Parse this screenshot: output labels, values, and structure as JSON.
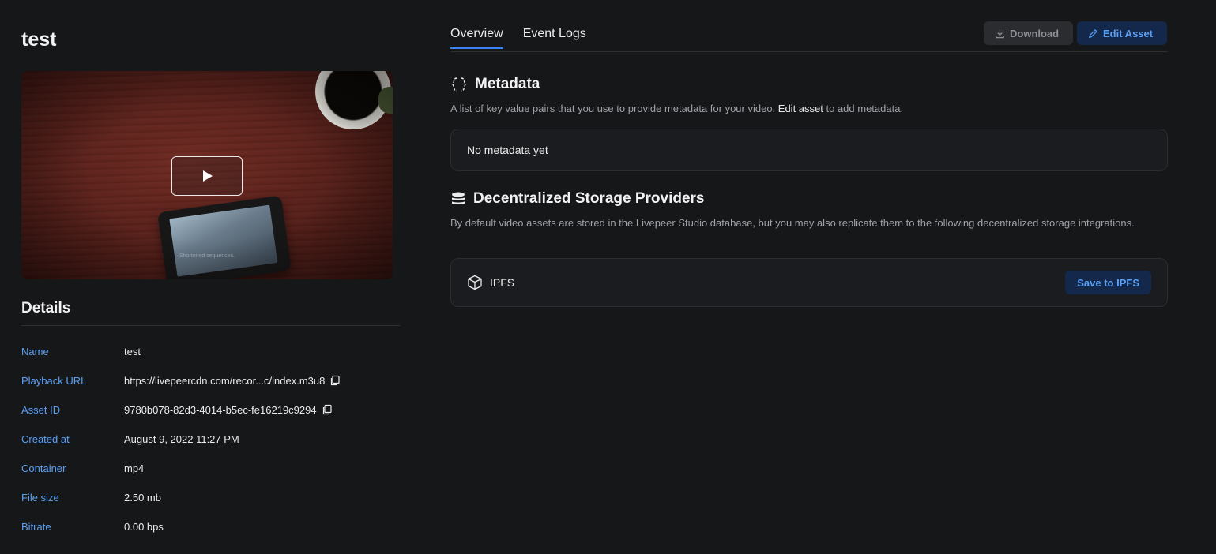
{
  "asset": {
    "title": "test"
  },
  "video": {
    "caption": "Shortened sequences."
  },
  "details": {
    "heading": "Details",
    "rows": [
      {
        "label": "Name",
        "value": "test",
        "copyable": false
      },
      {
        "label": "Playback URL",
        "value": "https://livepeercdn.com/recor...c/index.m3u8",
        "copyable": true
      },
      {
        "label": "Asset ID",
        "value": "9780b078-82d3-4014-b5ec-fe16219c9294",
        "copyable": true
      },
      {
        "label": "Created at",
        "value": "August 9, 2022 11:27 PM",
        "copyable": false
      },
      {
        "label": "Container",
        "value": "mp4",
        "copyable": false
      },
      {
        "label": "File size",
        "value": "2.50 mb",
        "copyable": false
      },
      {
        "label": "Bitrate",
        "value": "0.00 bps",
        "copyable": false
      }
    ]
  },
  "tabs": [
    {
      "label": "Overview",
      "active": true
    },
    {
      "label": "Event Logs",
      "active": false
    }
  ],
  "toolbar": {
    "download_label": "Download",
    "edit_label": "Edit Asset"
  },
  "metadata": {
    "heading": "Metadata",
    "desc_before": "A list of key value pairs that you use to provide metadata for your video. ",
    "desc_link": "Edit asset",
    "desc_after": " to add metadata.",
    "empty": "No metadata yet"
  },
  "storage": {
    "heading": "Decentralized Storage Providers",
    "desc": "By default video assets are stored in the Livepeer Studio database, but you may also replicate them to the following decentralized storage integrations.",
    "provider": "IPFS",
    "save_label": "Save to IPFS"
  },
  "colors": {
    "accent": "#3b82f6",
    "label_blue": "#5aa0f5",
    "background": "#161719"
  }
}
